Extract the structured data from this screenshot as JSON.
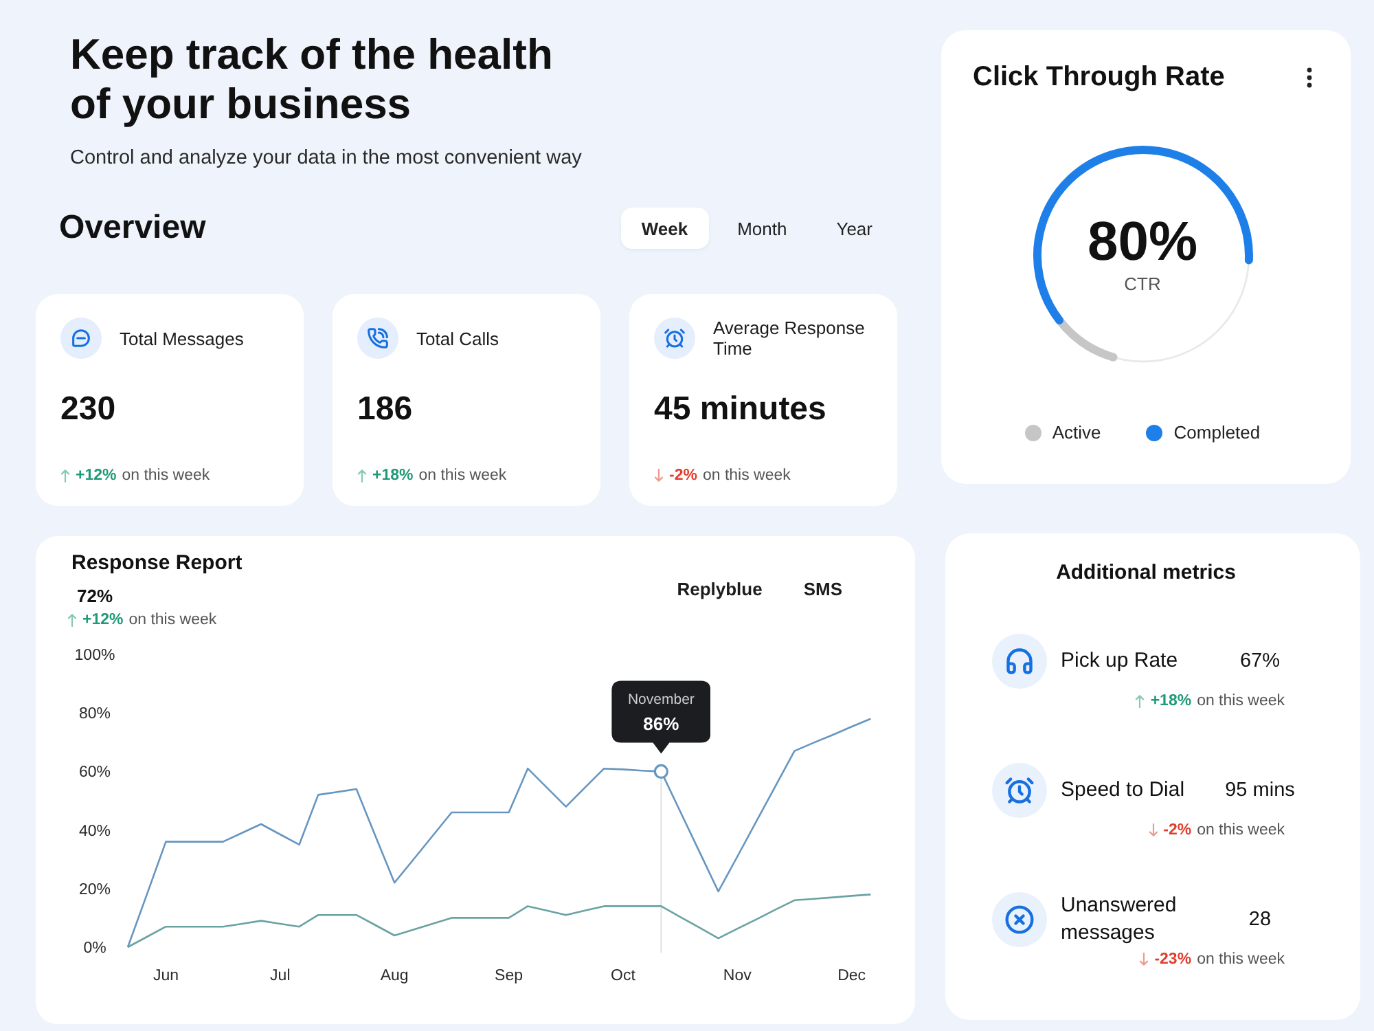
{
  "header": {
    "title": "Keep track of the health of your business",
    "subtitle": "Control and analyze your data in the most convenient way"
  },
  "overview": {
    "title": "Overview",
    "periods": [
      {
        "label": "Week",
        "selected": true
      },
      {
        "label": "Month",
        "selected": false
      },
      {
        "label": "Year",
        "selected": false
      }
    ]
  },
  "stats": [
    {
      "label": "Total Messages",
      "value": "230",
      "change": {
        "increase": true,
        "delta": "+12%",
        "note": "on this week"
      }
    },
    {
      "label": "Total Calls",
      "value": "186",
      "change": {
        "increase": true,
        "delta": "+18%",
        "note": "on this week"
      }
    },
    {
      "label": "Average Response Time",
      "value": "45 minutes",
      "change": {
        "increase": false,
        "delta": "-2%",
        "note": "on this week"
      }
    }
  ],
  "response_report": {
    "title": "Response Report",
    "value": "72%",
    "change": {
      "increase": true,
      "delta": "+12%",
      "note": "on this week"
    },
    "chart_data": {
      "type": "line",
      "categories": [
        null,
        null,
        "Jun",
        null,
        null,
        null,
        null,
        null,
        "Jul",
        null,
        null,
        null,
        null,
        null,
        "Aug",
        null,
        null,
        null,
        null,
        null,
        "Sep",
        null,
        null,
        null,
        null,
        null,
        "Oct",
        null,
        null,
        null,
        null,
        null,
        "Nov",
        null,
        null,
        null,
        null,
        null,
        "Dec",
        null
      ],
      "series": [
        {
          "name": "Replyblue",
          "color": "#6696c0",
          "values": [
            0,
            18,
            36,
            36,
            36,
            36,
            39,
            42,
            38.5,
            35,
            52,
            53,
            54,
            38,
            22,
            30,
            38,
            46,
            46,
            46,
            46,
            61,
            54.5,
            48,
            54.5,
            61,
            60.7,
            60.3,
            60,
            46.3,
            32.7,
            19,
            31,
            43,
            55,
            67,
            69.8,
            72.5,
            75.3,
            78
          ]
        },
        {
          "name": "SMS",
          "color": "#6aa2a2",
          "values": [
            0,
            3.5,
            7,
            7,
            7,
            7,
            8,
            9,
            8,
            7,
            11,
            11,
            11,
            7.5,
            4,
            6,
            8,
            10,
            10,
            10,
            10,
            14,
            12.5,
            11,
            12.5,
            14,
            14,
            14,
            14,
            10.3,
            6.7,
            3,
            6.3,
            9.5,
            12.8,
            16,
            16.5,
            17,
            17.5,
            18
          ]
        }
      ],
      "ylim": [
        0,
        100
      ],
      "yticks": [
        {
          "value": 0,
          "label": "0%"
        },
        {
          "value": 20,
          "label": "20%"
        },
        {
          "value": 40,
          "label": "40%"
        },
        {
          "value": 60,
          "label": "60%"
        },
        {
          "value": 80,
          "label": "80%"
        },
        {
          "value": 100,
          "label": "100%"
        }
      ],
      "annotations": [
        {
          "text": "November **86%**"
        }
      ]
    }
  },
  "click_through_rate": {
    "title": "Click Through Rate",
    "value": "80%",
    "caption": "CTR",
    "legend": [
      {
        "label": "Active",
        "color": "#c6c6c6"
      },
      {
        "label": "Completed",
        "color": "#1f7fe8"
      }
    ]
  },
  "additional_metrics": {
    "title": "Additional metrics",
    "items": [
      {
        "label": "Pick up Rate",
        "value": "67%",
        "change": {
          "increase": true,
          "delta": "+18%",
          "note": "on this week"
        }
      },
      {
        "label": "Speed to Dial",
        "value": "95 mins",
        "change": {
          "increase": false,
          "delta": "-2%",
          "note": "on this week"
        }
      },
      {
        "label": "Unanswered messages",
        "value": "28",
        "change": {
          "increase": false,
          "delta": "-23%",
          "note": "on this week"
        }
      }
    ]
  }
}
